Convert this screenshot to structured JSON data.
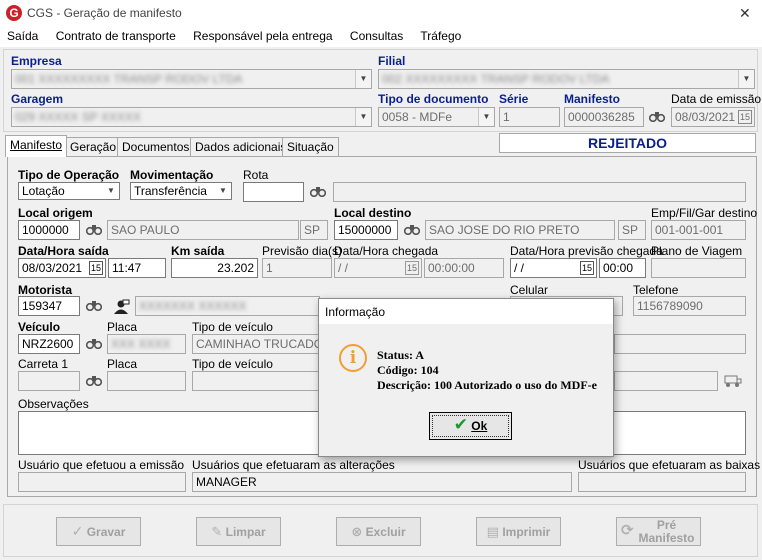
{
  "window": {
    "title": "CGS - Geração de manifesto",
    "close": "✕"
  },
  "menu": [
    "Saída",
    "Contrato de transporte",
    "Responsável pela entrega",
    "Consultas",
    "Tráfego"
  ],
  "header": {
    "empresa_label": "Empresa",
    "empresa_value": "001  XXXXXXXXX TRANSP RODOV LTDA",
    "filial_label": "Filial",
    "filial_value": "002  XXXXXXXXX TRANSP RODOV LTDA",
    "garagem_label": "Garagem",
    "garagem_value": "029  XXXXX SP  XXXXX",
    "tipo_doc_label": "Tipo de documento",
    "tipo_doc_value": "0058 - MDFe",
    "serie_label": "Série",
    "serie_value": "1",
    "manifesto_label": "Manifesto",
    "manifesto_value": "0000036285",
    "data_emissao_label": "Data de emissão",
    "data_emissao_value": "08/03/2021"
  },
  "tabs": [
    "Manifesto",
    "Geração",
    "Documentos",
    "Dados adicionais",
    "Situação"
  ],
  "status_banner": "REJEITADO",
  "form": {
    "tipo_operacao_label": "Tipo de Operação",
    "tipo_operacao_value": "Lotação",
    "movimentacao_label": "Movimentação",
    "movimentacao_value": "Transferência",
    "rota_label": "Rota",
    "rota_value": "",
    "local_origem_label": "Local origem",
    "local_origem_code": "1000000",
    "local_origem_city": "SAO PAULO",
    "local_origem_uf": "SP",
    "local_destino_label": "Local destino",
    "local_destino_code": "15000000",
    "local_destino_city": "SAO JOSE DO RIO PRETO",
    "local_destino_uf": "SP",
    "emp_fil_gar_label": "Emp/Fil/Gar destino",
    "emp_fil_gar_value": "001-001-001",
    "data_saida_label": "Data/Hora saída",
    "data_saida_value": "08/03/2021",
    "hora_saida_value": "11:47",
    "km_saida_label": "Km saída",
    "km_saida_value": "23.202",
    "previsao_dias_label": "Previsão dia(s)",
    "previsao_dias_value": "1",
    "data_chegada_label": "Data/Hora chegada",
    "data_chegada_value": " / /",
    "hora_chegada_value": "00:00:00",
    "data_prev_chegada_label": "Data/Hora previsão chegada",
    "data_prev_chegada_value": " / /",
    "hora_prev_chegada_value": "00:00",
    "plano_viagem_label": "Plano de Viagem",
    "plano_viagem_value": "",
    "motorista_label": "Motorista",
    "motorista_code": "159347",
    "motorista_name": "XXXXXXX XXXXXX",
    "celular_label": "Celular",
    "celular_value": "",
    "telefone_label": "Telefone",
    "telefone_value": "1156789090",
    "veiculo_label": "Veículo",
    "veiculo_value": "NRZ2600",
    "placa_label": "Placa",
    "placa_value": "XXX XXXX",
    "tipo_veiculo_label": "Tipo de veículo",
    "tipo_veiculo_value": "CAMINHAO TRUCADO BA",
    "carreta_label": "Carreta 1",
    "carreta_value": "",
    "placa2_label": "Placa",
    "placa2_value": "",
    "tipo_veiculo2_label": "Tipo de veículo",
    "tipo_veiculo2_value": "",
    "observacoes_label": "Observações",
    "usuario_emissao_label": "Usuário que efetuou a emissão",
    "usuario_emissao_value": "",
    "usuarios_alteracoes_label": "Usuários que efetuaram as alterações",
    "usuarios_alteracoes_value": "MANAGER",
    "usuarios_baixas_label": "Usuários que efetuaram as baixas",
    "usuarios_baixas_value": ""
  },
  "dialog": {
    "title": "Informação",
    "status": "Status: A",
    "codigo": "Código: 104",
    "descricao": "Descrição: 100 Autorizado o uso do MDF-e",
    "ok_label": "Ok"
  },
  "footer": {
    "gravar": "Gravar",
    "limpar": "Limpar",
    "excluir": "Excluir",
    "imprimir": "Imprimir",
    "pre_manifesto_1": "Pré",
    "pre_manifesto_2": "Manifesto"
  },
  "colors": {
    "accent": "#0a1f8f",
    "logo_red": "#cc1f27",
    "dialog_icon": "#f0a030",
    "ok_check": "#1a9a2a"
  }
}
